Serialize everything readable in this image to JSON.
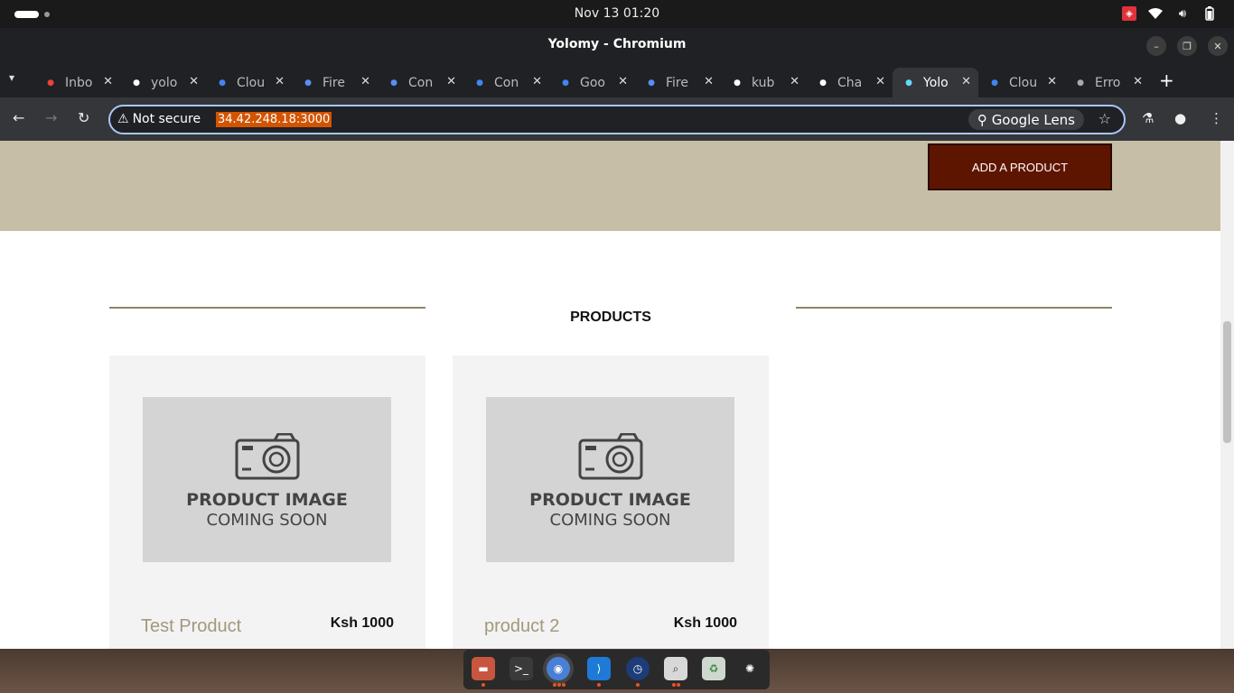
{
  "topbar": {
    "clock": "Nov 13  01:20"
  },
  "window": {
    "title": "Yolomy - Chromium"
  },
  "tabs": [
    {
      "label": "Inbox",
      "icon": "gmail-icon",
      "color": "#ea4335"
    },
    {
      "label": "yolo",
      "icon": "github-icon",
      "color": "#ffffff"
    },
    {
      "label": "Cloud",
      "icon": "google-cloud-icon",
      "color": "#4285f4"
    },
    {
      "label": "Fire",
      "icon": "firebase-shield-icon",
      "color": "#5b8cf7"
    },
    {
      "label": "Con",
      "icon": "api-icon",
      "color": "#5b8cf7"
    },
    {
      "label": "Con",
      "icon": "google-cloud-icon",
      "color": "#4285f4"
    },
    {
      "label": "Goo",
      "icon": "google-cloud-icon",
      "color": "#4285f4"
    },
    {
      "label": "Fire",
      "icon": "firebase-shield-icon",
      "color": "#5b8cf7"
    },
    {
      "label": "kub",
      "icon": "google-icon",
      "color": "#ffffff"
    },
    {
      "label": "Cha",
      "icon": "chatgpt-icon",
      "color": "#ffffff"
    },
    {
      "label": "Yolo",
      "icon": "react-icon",
      "color": "#61dafb"
    },
    {
      "label": "Clou",
      "icon": "google-cloud-icon",
      "color": "#4285f4"
    },
    {
      "label": "Erro",
      "icon": "globe-icon",
      "color": "#aaaaaa"
    }
  ],
  "toolbar": {
    "security_label": "Not secure",
    "url": "34.42.248.18:3000",
    "lens_label": "Google Lens"
  },
  "page": {
    "add_button_label": "ADD A PRODUCT",
    "section_title": "PRODUCTS",
    "placeholder_line1": "PRODUCT IMAGE",
    "placeholder_line2": "COMING SOON",
    "products": [
      {
        "name": "Test Product",
        "price": "Ksh 1000"
      },
      {
        "name": "product 2",
        "price": "Ksh 1000"
      }
    ]
  },
  "colors": {
    "hero_bg": "#c6bea7",
    "button_bg": "#5e1500",
    "accent_rule": "#8f8668",
    "product_name": "#a3987a",
    "url_highlight": "#d35400"
  },
  "dock": {
    "apps": [
      "files-icon",
      "terminal-icon",
      "chromium-icon",
      "vscode-icon",
      "clock-app-icon",
      "image-viewer-icon",
      "trash-icon",
      "ubuntu-logo-icon"
    ]
  }
}
